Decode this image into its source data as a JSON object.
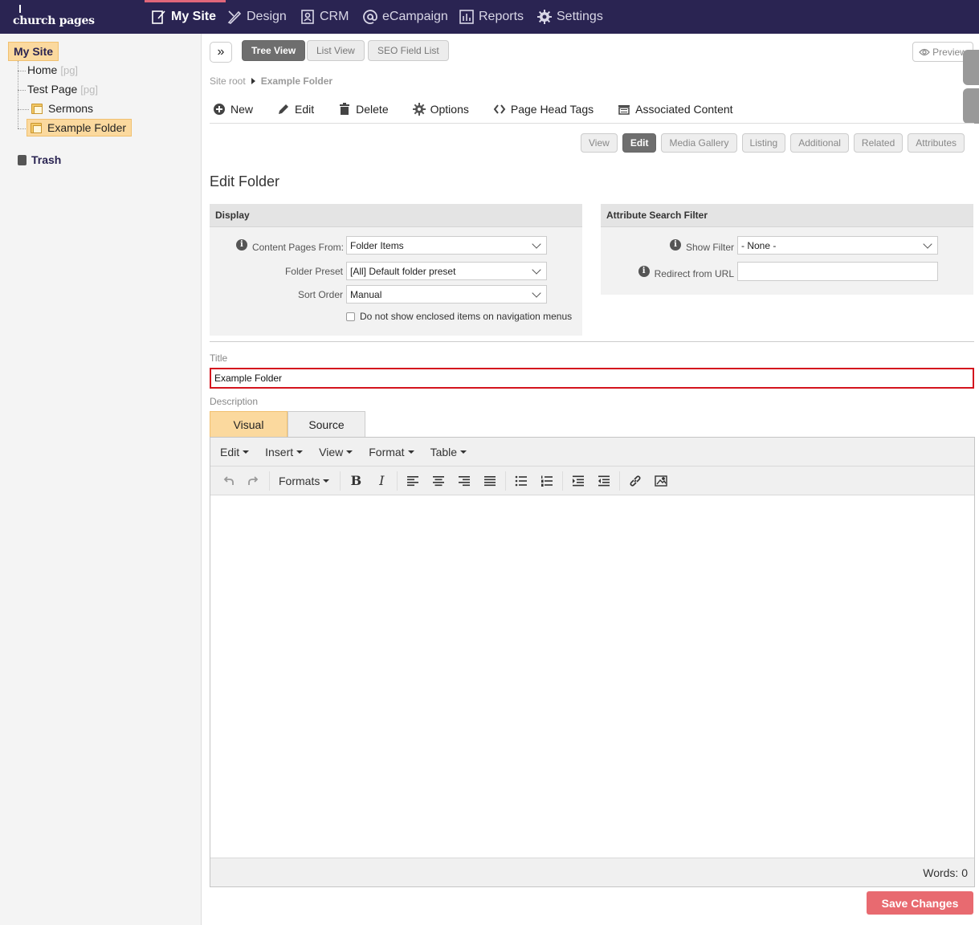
{
  "app": {
    "logo": "church pages"
  },
  "topnav": [
    {
      "label": "My Site",
      "icon": "edit-page-icon",
      "active": true
    },
    {
      "label": "Design",
      "icon": "design-pencil-icon"
    },
    {
      "label": "CRM",
      "icon": "contact-card-icon"
    },
    {
      "label": "eCampaign",
      "icon": "at-sign-icon"
    },
    {
      "label": "Reports",
      "icon": "bar-chart-icon"
    },
    {
      "label": "Settings",
      "icon": "gear-icon"
    }
  ],
  "sidebar": {
    "root": "My Site",
    "items": [
      {
        "label": "Home",
        "tag": "[pg]"
      },
      {
        "label": "Test Page",
        "tag": "[pg]"
      },
      {
        "label": "Sermons",
        "icon": "folder-icon"
      },
      {
        "label": "Example Folder",
        "icon": "folder-icon",
        "selected": true
      }
    ],
    "trash": "Trash"
  },
  "viewtabs": [
    "Tree View",
    "List View",
    "SEO Field List"
  ],
  "preview": "Preview",
  "breadcrumb": {
    "root": "Site root",
    "current": "Example Folder"
  },
  "actions": [
    "New",
    "Edit",
    "Delete",
    "Options",
    "Page Head Tags",
    "Associated Content"
  ],
  "subtabs": [
    "View",
    "Edit",
    "Media Gallery",
    "Listing",
    "Additional",
    "Related",
    "Attributes"
  ],
  "page_title": "Edit Folder",
  "display": {
    "heading": "Display",
    "content_pages_label": "Content Pages From:",
    "content_pages_value": "Folder Items",
    "preset_label": "Folder Preset",
    "preset_value": "[All] Default folder preset",
    "sort_label": "Sort Order",
    "sort_value": "Manual",
    "checkbox_label": "Do not show enclosed items on navigation menus"
  },
  "attr_filter": {
    "heading": "Attribute Search Filter",
    "show_filter_label": "Show Filter",
    "show_filter_value": "- None -",
    "redirect_label": "Redirect from URL",
    "redirect_value": ""
  },
  "title_field": {
    "label": "Title",
    "value": "Example Folder"
  },
  "description": {
    "label": "Description",
    "tabs": [
      "Visual",
      "Source"
    ],
    "menus": [
      "Edit",
      "Insert",
      "View",
      "Format",
      "Table"
    ],
    "formats_label": "Formats",
    "word_count": "Words: 0"
  },
  "save_label": "Save Changes"
}
